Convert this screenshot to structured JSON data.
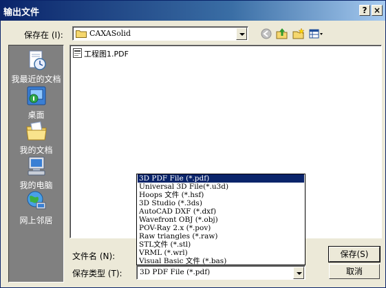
{
  "window": {
    "title": "输出文件",
    "help_label": "?",
    "close_label": "×"
  },
  "save_in": {
    "label": "保存在",
    "hotkey": "(I):",
    "folder": "CAXASolid"
  },
  "toolbar": {
    "icons": [
      "back-icon",
      "up-folder-icon",
      "new-folder-icon",
      "view-menu-icon"
    ]
  },
  "places": [
    {
      "label": "我最近的文档",
      "icon": "recent-documents-icon"
    },
    {
      "label": "桌面",
      "icon": "desktop-icon"
    },
    {
      "label": "我的文档",
      "icon": "my-documents-icon"
    },
    {
      "label": "我的电脑",
      "icon": "my-computer-icon"
    },
    {
      "label": "网上邻居",
      "icon": "network-places-icon"
    }
  ],
  "files": [
    {
      "name": "工程图1.PDF",
      "icon": "pdf-file-icon"
    }
  ],
  "filename": {
    "label": "文件名",
    "hotkey": "(N):",
    "value": ""
  },
  "filetype": {
    "label": "保存类型",
    "hotkey": "(T):",
    "selected": "3D PDF File (*.pdf)",
    "options": [
      "3D PDF File (*.pdf)",
      "Universal 3D File(*.u3d)",
      "Hoops 文件 (*.hsf)",
      "3D Studio (*.3ds)",
      "AutoCAD DXF (*.dxf)",
      "Wavefront OBJ (*.obj)",
      "POV-Ray 2.x (*.pov)",
      "Raw triangles (*.raw)",
      "STL文件 (*.stl)",
      "VRML (*.wrl)",
      "Visual Basic 文件 (*.bas)"
    ]
  },
  "buttons": {
    "save": "保存(S)",
    "cancel": "取消"
  }
}
